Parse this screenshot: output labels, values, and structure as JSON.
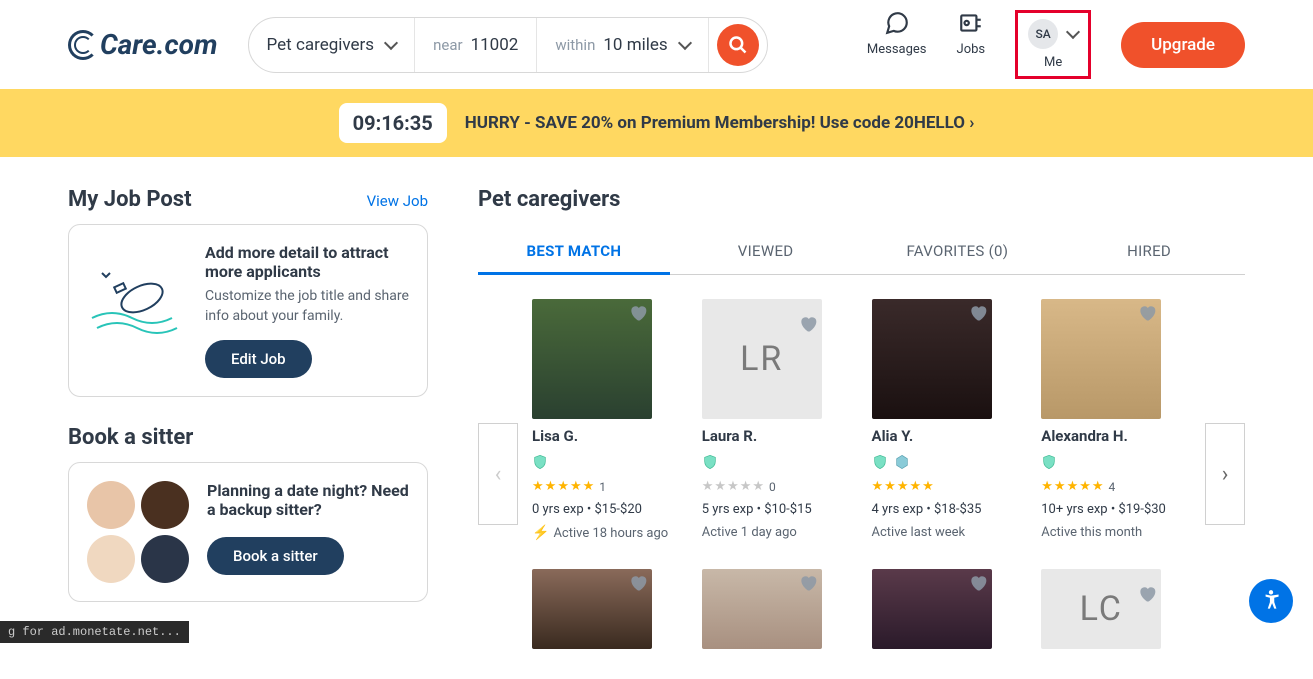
{
  "header": {
    "logo_text": "Care.com",
    "search": {
      "category": "Pet caregivers",
      "near_label": "near",
      "zip": "11002",
      "within_label": "within",
      "radius": "10 miles"
    },
    "nav": {
      "messages": "Messages",
      "jobs": "Jobs",
      "me_initials": "SA",
      "me_label": "Me"
    },
    "upgrade": "Upgrade"
  },
  "promo": {
    "timer": "09:16:35",
    "text": "HURRY - SAVE 20% on Premium Membership! Use code 20HELLO ›"
  },
  "job_post": {
    "heading": "My Job Post",
    "view_link": "View Job",
    "card_title": "Add more detail to attract more applicants",
    "card_sub": "Customize the job title and share info about your family.",
    "edit_btn": "Edit Job"
  },
  "book": {
    "heading": "Book a sitter",
    "card_title": "Planning a date night? Need a backup sitter?",
    "btn": "Book a sitter"
  },
  "results": {
    "heading": "Pet caregivers",
    "tabs": {
      "best": "BEST MATCH",
      "viewed": "VIEWED",
      "favorites": "FAVORITES (0)",
      "hired": "HIRED"
    },
    "caregivers": [
      {
        "name": "Lisa G.",
        "initials": "",
        "reviews": "1",
        "stars": 5,
        "exp": "0 yrs exp",
        "rate": "$15-$20",
        "active": "Active 18 hours ago",
        "bolt": true,
        "badge2": false
      },
      {
        "name": "Laura R.",
        "initials": "LR",
        "reviews": "0",
        "stars": 0,
        "exp": "5 yrs exp",
        "rate": "$10-$15",
        "active": "Active 1 day ago",
        "bolt": false,
        "badge2": false
      },
      {
        "name": "Alia Y.",
        "initials": "",
        "reviews": "",
        "stars": 5,
        "exp": "4 yrs exp",
        "rate": "$18-$35",
        "active": "Active last week",
        "bolt": false,
        "badge2": true
      },
      {
        "name": "Alexandra H.",
        "initials": "",
        "reviews": "4",
        "stars": 5,
        "exp": "10+ yrs exp",
        "rate": "$19-$30",
        "active": "Active this month",
        "bolt": false,
        "badge2": false
      }
    ],
    "row2_initials": "LC"
  },
  "status": "g for ad.monetate.net..."
}
